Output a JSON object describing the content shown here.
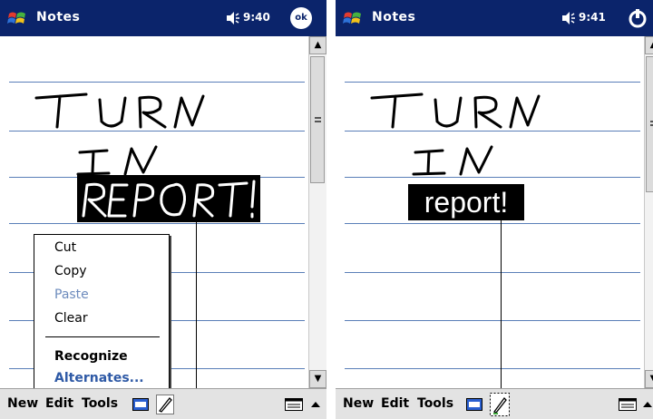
{
  "left_screen": {
    "title": "Notes",
    "clock": "9:40",
    "ok_label": "ok",
    "ink_text": "TURN IN REPORT!",
    "menubar": {
      "new": "New",
      "edit": "Edit",
      "tools": "Tools"
    },
    "context_menu": {
      "items": [
        "Cut",
        "Copy",
        "Paste",
        "Clear",
        "Recognize",
        "Alternates..."
      ]
    }
  },
  "right_screen": {
    "title": "Notes",
    "clock": "9:41",
    "ink_text": "TURN IN",
    "recognized_text": "report!",
    "menubar": {
      "new": "New",
      "edit": "Edit",
      "tools": "Tools"
    }
  },
  "colors": {
    "titlebar": "#0b246b",
    "ruled_line": "#5a7fb8",
    "menubar": "#e3e3e3",
    "disabled_text": "#6d8bbd"
  },
  "icons": [
    "windows-start-icon",
    "speaker-icon",
    "ok-icon",
    "keyboard-icon",
    "pen-icon",
    "sip-icon",
    "scroll-up-icon",
    "scroll-down-icon"
  ]
}
